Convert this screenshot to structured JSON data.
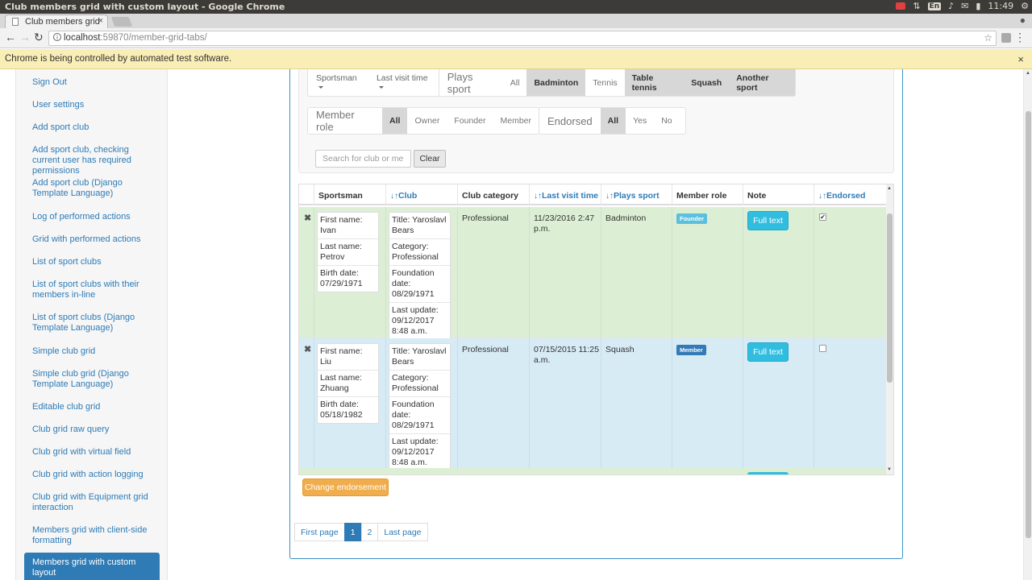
{
  "os": {
    "window_title": "Club members grid with custom layout - Google Chrome",
    "lang": "En",
    "time": "11:49"
  },
  "browser": {
    "tab_title": "Club members grid",
    "url_host": "localhost",
    "url_path": ":59870/member-grid-tabs/",
    "infobar_text": "Chrome is being controlled by automated test software."
  },
  "sidebar": {
    "items": [
      "Sign Out",
      "User settings",
      "Add sport club",
      "Add sport club, checking current user has required permissions",
      "Add sport club (Django Template Language)",
      "Log of performed actions",
      "Grid with performed actions",
      "List of sport clubs",
      "List of sport clubs with their members in-line",
      "List of sport clubs (Django Template Language)",
      "Simple club grid",
      "Simple club grid (Django Template Language)",
      "Editable club grid",
      "Club grid raw query",
      "Club grid with virtual field",
      "Club grid with action logging",
      "Club grid with Equipment grid interaction",
      "Members grid with client-side formatting"
    ],
    "active_item": "Members grid with custom layout"
  },
  "filters": {
    "sportsman_dropdown": "Sportsman",
    "last_visit_dropdown": "Last visit time",
    "plays_sport_caption": "Plays sport",
    "plays_sport_options": [
      "All",
      "Badminton",
      "Tennis",
      "Table tennis",
      "Squash",
      "Another sport"
    ],
    "member_role_caption": "Member role",
    "member_role_options": [
      "All",
      "Owner",
      "Founder",
      "Member"
    ],
    "endorsed_caption": "Endorsed",
    "endorsed_options": [
      "All",
      "Yes",
      "No"
    ],
    "search_placeholder": "Search for club or meml",
    "clear_label": "Clear"
  },
  "grid": {
    "columns": {
      "sportsman": "Sportsman",
      "club": "Club",
      "club_category": "Club category",
      "last_visit_time": "Last visit time",
      "plays_sport": "Plays sport",
      "member_role": "Member role",
      "note": "Note",
      "endorsed": "Endorsed"
    },
    "sort_arrows": "↓↑",
    "delete_icon": "✖",
    "rows": [
      {
        "first_name": "First name: Ivan",
        "last_name": "Last name: Petrov",
        "birth_date": "Birth date: 07/29/1971",
        "club_title": "Title: Yaroslavl Bears",
        "club_category_li": "Category: Professional",
        "foundation": "Foundation date: 08/29/1971",
        "last_update": "Last update: 09/12/2017 8:48 a.m.",
        "category": "Professional",
        "last_visit": "11/23/2016 2:47 p.m.",
        "sport": "Badminton",
        "role": "Founder",
        "note_button": "Full text",
        "endorsed_mark": "✔"
      },
      {
        "first_name": "First name: Liu",
        "last_name": "Last name: Zhuang",
        "birth_date": "Birth date: 05/18/1982",
        "club_title": "Title: Yaroslavl Bears",
        "club_category_li": "Category: Professional",
        "foundation": "Foundation date: 08/29/1971",
        "last_update": "Last update: 09/12/2017 8:48 a.m.",
        "category": "Professional",
        "last_visit": "07/15/2015 11:25 a.m.",
        "sport": "Squash",
        "role": "Member",
        "note_button": "Full text",
        "endorsed_mark": ""
      }
    ]
  },
  "actions": {
    "change_endorsement": "Change endorsement"
  },
  "pagination": {
    "first": "First page",
    "pages": [
      "1",
      "2"
    ],
    "current": "1",
    "last": "Last page"
  }
}
